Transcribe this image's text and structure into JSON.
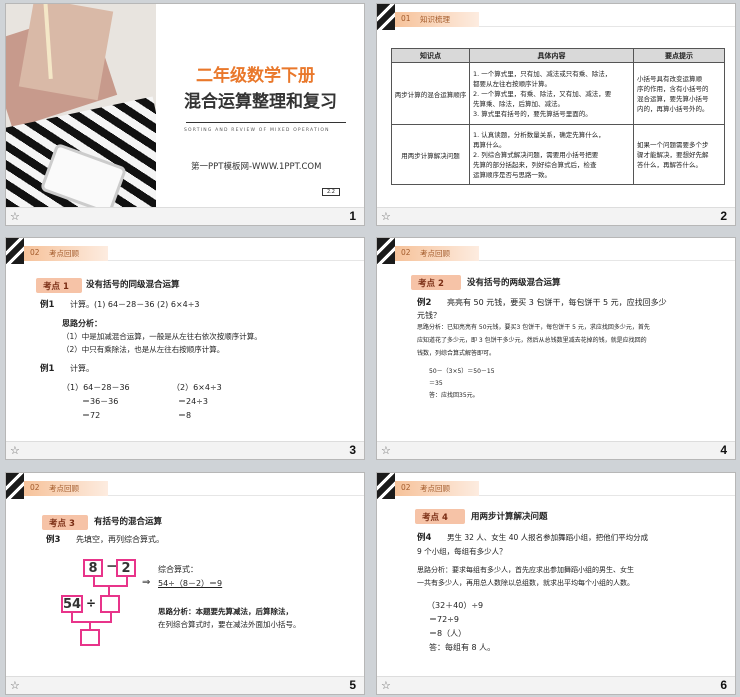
{
  "slides": [
    {
      "num": "1",
      "title_top": "二年级数学下册",
      "title_main": "混合运算整理和复习",
      "subtitle_en": "SORTING AND REVIEW OF MIXED OPERATION",
      "site": "第一PPT模板网-WWW.1PPT.COM",
      "badge": "2.2"
    },
    {
      "num": "2",
      "section_no": "01",
      "section": "知识梳理",
      "table": {
        "headers": [
          "知识点",
          "具体内容",
          "要点提示"
        ],
        "rows": [
          {
            "point": "两步计算的混合运算顺序",
            "content": [
              "1. 一个算式里，只有加、减法或只有乘、除法，",
              "都要从左往右按顺序计算。",
              "2. 一个算式里，有乘、除法，又有加、减法，要",
              "先算乘、除法，后算加、减法。",
              "3. 算式里有括号的，要先算括号里面的。"
            ],
            "tip": [
              "小括号具有改变运算顺",
              "序的作用，含有小括号的",
              "混合运算，要先算小括号",
              "内的，再算小括号外的。"
            ]
          },
          {
            "point": "用两步计算解决问题",
            "content": [
              "1. 认真读题，分析数量关系，确定先算什么，",
              "再算什么。",
              "2. 列综合算式解决问题，需要用小括号把要",
              "先算的部分括起来，列好综合算式后，检查",
              "运算顺序是否与思路一致。"
            ],
            "tip": [
              "如果一个问题需要多个步",
              "骤才能解决，要想好先解",
              "答什么，再解答什么。"
            ]
          }
        ]
      }
    },
    {
      "num": "3",
      "section_no": "02",
      "section": "考点回顾",
      "kd_label": "考点 1",
      "kd_title": "没有括号的同级混合运算",
      "ex": "例1",
      "ex_text": "计算。(1) 64－28－36      (2) 6×4÷3",
      "anal_title": "思路分析：",
      "anal1": "（1）中是加减混合运算，一般是从左往右依次按顺序计算。",
      "anal2": "（2）中只有乘除法，也是从左往右按顺序计算。",
      "ex2": "例1",
      "ex2_text": "计算。",
      "l1": "（1）64－28－36",
      "l1a": "＝36－36",
      "l1b": "＝72",
      "l2": "（2）6×4÷3",
      "l2a": "＝24÷3",
      "l2b": "＝8"
    },
    {
      "num": "4",
      "section_no": "02",
      "section": "考点回顾",
      "kd_label": "考点 2",
      "kd_title": "没有括号的两级混合运算",
      "ex": "例2",
      "ex_text": "亮亮有 50 元钱，要买 3 包饼干，每包饼干 5 元，应找回多少",
      "ex_text2": "元钱？",
      "anal": [
        "思路分析：已知亮亮有 50元钱，要买3 包饼干，每包饼干  5 元，求应找回多少元，首先",
        "应知道花了多少元，即  3  包饼干多少元，然后从总钱数里减去花掉的钱，就是应找回的",
        "钱数，列综合算式解答即可。"
      ],
      "s1": "50－（3×5）＝50－15",
      "s2": "＝35",
      "s3": "答：应找回35元。"
    },
    {
      "num": "5",
      "section_no": "02",
      "section": "考点回顾",
      "kd_label": "考点 3",
      "kd_title": "有括号的混合运算",
      "ex": "例3",
      "ex_text": "先填空，再列综合算式。",
      "box1": "8",
      "box2": "2",
      "box3": "54",
      "op1": "－",
      "op2": "÷",
      "arrow": "⇒",
      "formula_label": "综合算式：",
      "formula": "54÷（8－2）＝9",
      "anal": [
        "思路分析：本题要先算减法，后算除法，",
        "在列综合算式时，要在减法外面加小括号。"
      ]
    },
    {
      "num": "6",
      "section_no": "02",
      "section": "考点回顾",
      "kd_label": "考点 4",
      "kd_title": "用两步计算解决问题",
      "ex": "例4",
      "ex_text": "男生 32 人、女生 40 人报名参加舞蹈小组，把他们平均分成",
      "ex_text2": "9 个小组，每组有多少人？",
      "anal": [
        "思路分析：要求每组有多少人，首先应求出参加舞蹈小组的男生、女生",
        "一共有多少人，再用总人数除以总组数，就求出平均每个小组的人数。"
      ],
      "s1": "（32＋40）÷9",
      "s2": "＝72÷9",
      "s3": "＝8（人）",
      "s4": "答：每组有 8 人。"
    }
  ],
  "colors": {
    "orange": "#e9782b",
    "red": "#e0241e",
    "pink": "#e8348a",
    "kd": "#f6c3a7"
  }
}
